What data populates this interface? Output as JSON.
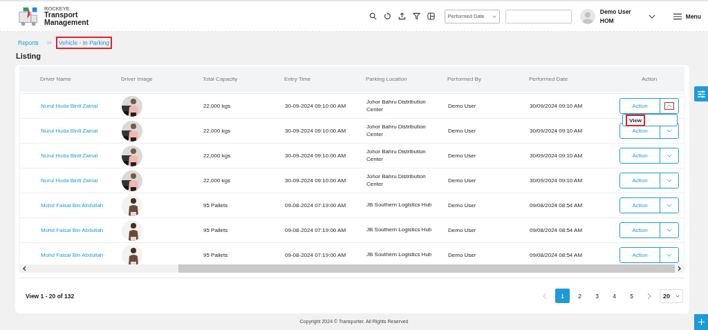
{
  "app": {
    "brand_small": "ROCKEYE",
    "brand_title": "Transport Management"
  },
  "header": {
    "date_filter": {
      "value": "Performed Date"
    },
    "user": {
      "name": "Demo User",
      "role": "HOM"
    },
    "menu_label": "Menu"
  },
  "breadcrumb": [
    {
      "label": "Reports",
      "highlighted": false
    },
    {
      "label": "Vehicle - In Parking",
      "highlighted": true
    }
  ],
  "page_title": "Listing",
  "table": {
    "columns": [
      "Driver Name",
      "Driver Image",
      "Total Capacity",
      "Entry Time",
      "Parking Location",
      "Performed By",
      "Performed Date",
      "Action"
    ],
    "rows": [
      {
        "driver_name": "Nurul Huda Binti Zainal",
        "image": {
          "kind": "picture"
        },
        "total_capacity": "22,000 kgs",
        "entry_time": "30-09-2024 09:10:00 AM",
        "parking_location": "Johor Bahru Distribution Center",
        "performed_by": "Demo User",
        "performed_date": "30/09/2024 09:10 AM",
        "action": "Action",
        "menu_open": true,
        "menu_items": [
          {
            "label": "View",
            "highlighted": true
          }
        ]
      },
      {
        "driver_name": "Nurul Huda Binti Zainal",
        "image": {
          "kind": "picture"
        },
        "total_capacity": "22,000 kgs",
        "entry_time": "30-09-2024 09:10:00 AM",
        "parking_location": "Johor Bahru Distribution Center",
        "performed_by": "Demo User",
        "performed_date": "30/09/2024 09:10 AM",
        "action": "Action",
        "menu_open": false
      },
      {
        "driver_name": "Nurul Huda Binti Zainal",
        "image": {
          "kind": "picture"
        },
        "total_capacity": "22,000 kgs",
        "entry_time": "30-09-2024 09:10:00 AM",
        "parking_location": "Johor Bahru Distribution Center",
        "performed_by": "Demo User",
        "performed_date": "30/09/2024 09:10 AM",
        "action": "Action",
        "menu_open": false
      },
      {
        "driver_name": "Nurul Huda Binti Zainal",
        "image": {
          "kind": "picture"
        },
        "total_capacity": "22,000 kgs",
        "entry_time": "30-09-2024 09:10:00 AM",
        "parking_location": "Johor Bahru Distribution Center",
        "performed_by": "Demo User",
        "performed_date": "30/09/2024 09:10 AM",
        "action": "Action",
        "menu_open": false
      },
      {
        "driver_name": "Mohd Faisal Bin Abdullah",
        "image": {
          "kind": "picture"
        },
        "total_capacity": "95 Pallets",
        "entry_time": "09-08-2024 07:19:00 AM",
        "parking_location": "JB Southern Logistics Hub",
        "performed_by": "Demo User",
        "performed_date": "09/08/2024 08:54 AM",
        "action": "Action",
        "menu_open": false
      },
      {
        "driver_name": "Mohd Faisal Bin Abdullah",
        "image": {
          "kind": "picture"
        },
        "total_capacity": "95 Pallets",
        "entry_time": "09-08-2024 07:19:00 AM",
        "parking_location": "JB Southern Logistics Hub",
        "performed_by": "Demo User",
        "performed_date": "09/08/2024 08:54 AM",
        "action": "Action",
        "menu_open": false
      },
      {
        "driver_name": "Mohd Faisal Bin Abdullah",
        "image": {
          "kind": "picture"
        },
        "total_capacity": "95 Pallets",
        "entry_time": "09-08-2024 07:19:00 AM",
        "parking_location": "JB Southern Logistics Hub",
        "performed_by": "Demo User",
        "performed_date": "09/08/2024 08:54 AM",
        "action": "Action",
        "menu_open": false
      }
    ]
  },
  "pagination": {
    "summary": "View 1 - 20 of 132",
    "pages": [
      {
        "label": "1",
        "selected": true
      },
      {
        "label": "2",
        "selected": false
      },
      {
        "label": "3",
        "selected": false
      },
      {
        "label": "4",
        "selected": false
      },
      {
        "label": "5",
        "selected": false
      }
    ],
    "page_size": "20"
  },
  "footer": "Copyright 2024 © Transporter. All Rights Reserved"
}
